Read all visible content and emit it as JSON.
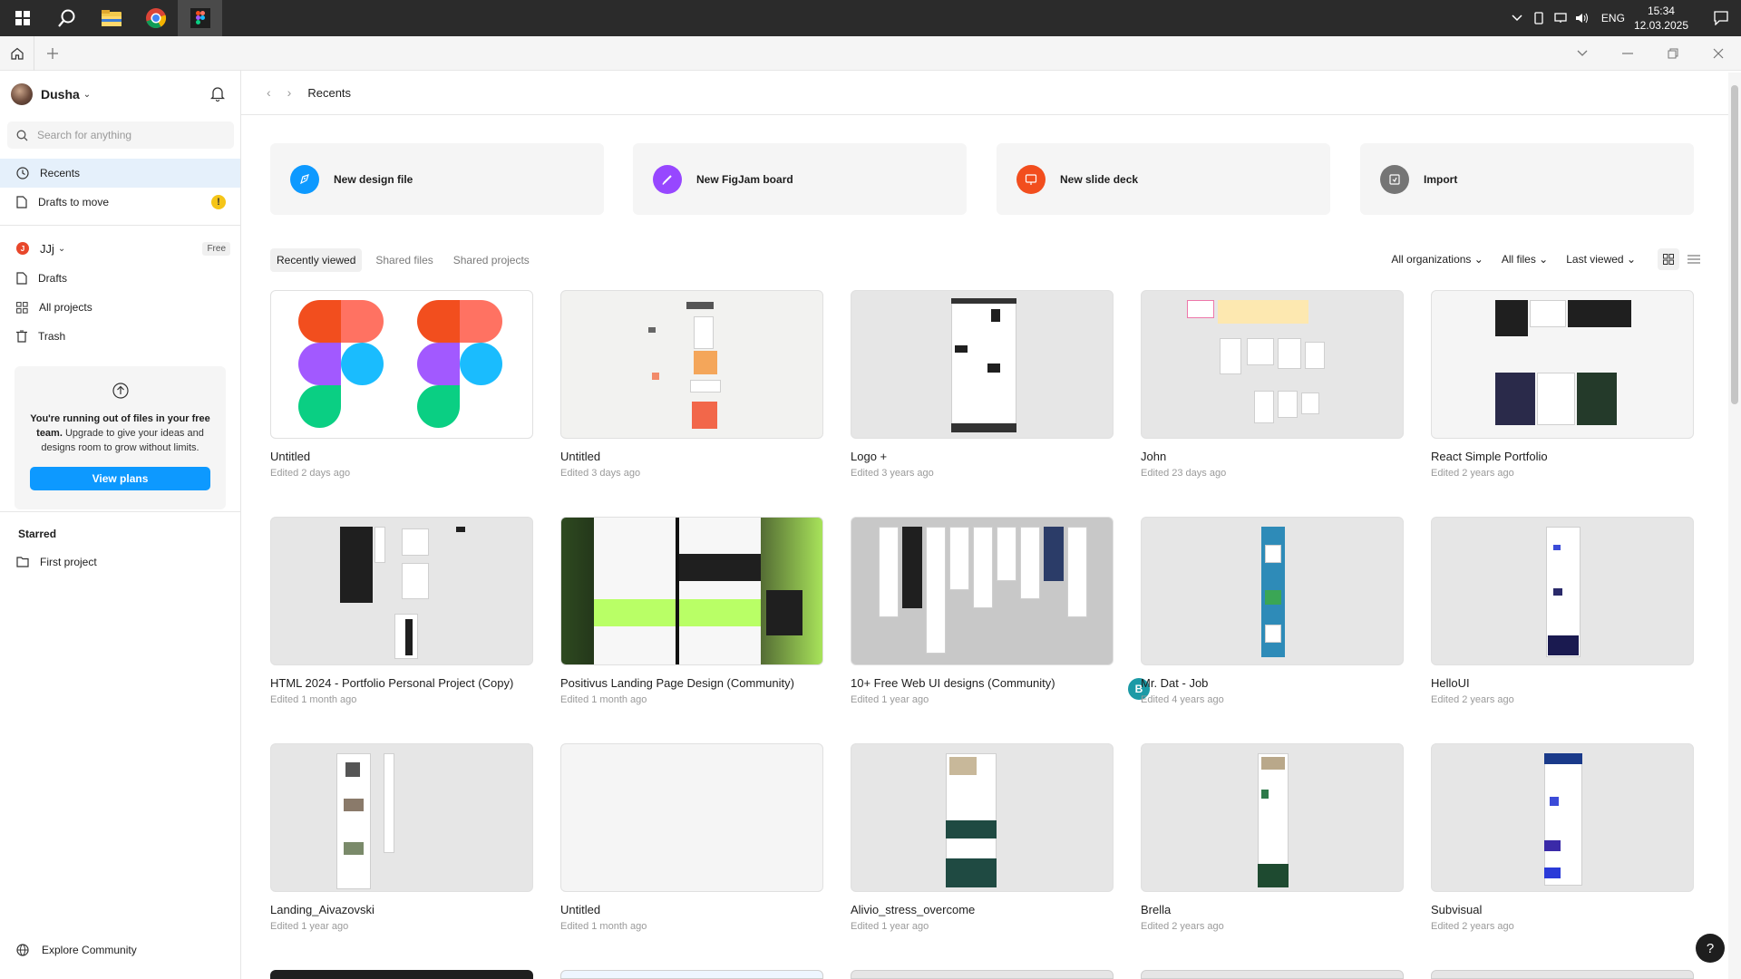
{
  "taskbar": {
    "lang": "ENG",
    "time": "15:34",
    "date": "12.03.2025"
  },
  "sidebar": {
    "user_name": "Dusha",
    "search_placeholder": "Search for anything",
    "nav": [
      {
        "label": "Recents"
      },
      {
        "label": "Drafts to move",
        "badge": "!"
      }
    ],
    "team": {
      "initial": "J",
      "name": "JJj",
      "plan": "Free"
    },
    "team_nav": [
      {
        "label": "Drafts"
      },
      {
        "label": "All projects"
      },
      {
        "label": "Trash"
      }
    ],
    "upgrade": {
      "bold": "You're running out of files in your free team.",
      "text": " Upgrade to give your ideas and designs room to grow without limits.",
      "button": "View plans"
    },
    "starred_title": "Starred",
    "starred": [
      {
        "label": "First project"
      }
    ],
    "explore": "Explore Community"
  },
  "main": {
    "breadcrumb": "Recents",
    "actions": [
      {
        "label": "New design file",
        "color": "#0d99ff"
      },
      {
        "label": "New FigJam board",
        "color": "#9747ff"
      },
      {
        "label": "New slide deck",
        "color": "#f24e1e"
      },
      {
        "label": "Import",
        "color": "#757575"
      }
    ],
    "filters": [
      "Recently viewed",
      "Shared files",
      "Shared projects"
    ],
    "sorts": [
      "All organizations",
      "All files",
      "Last viewed"
    ],
    "files": [
      {
        "name": "Untitled",
        "edited": "Edited 2 days ago"
      },
      {
        "name": "Untitled",
        "edited": "Edited 3 days ago"
      },
      {
        "name": "Logo +",
        "edited": "Edited 3 years ago"
      },
      {
        "name": "John",
        "edited": "Edited 23 days ago"
      },
      {
        "name": "React Simple Portfolio",
        "edited": "Edited 2 years ago"
      },
      {
        "name": "HTML 2024 - Portfolio Personal Project (Copy)",
        "edited": "Edited 1 month ago"
      },
      {
        "name": "Positivus Landing Page Design (Community)",
        "edited": "Edited 1 month ago"
      },
      {
        "name": "10+ Free Web UI designs (Community)",
        "edited": "Edited 1 year ago",
        "badge": "B"
      },
      {
        "name": "Mr. Dat - Job",
        "edited": "Edited 4 years ago"
      },
      {
        "name": "HelloUI",
        "edited": "Edited 2 years ago"
      },
      {
        "name": "Landing_Aivazovski",
        "edited": "Edited 1 year ago"
      },
      {
        "name": "Untitled",
        "edited": "Edited 1 month ago"
      },
      {
        "name": "Alivio_stress_overcome",
        "edited": "Edited 1 year ago"
      },
      {
        "name": "Brella",
        "edited": "Edited 2 years ago"
      },
      {
        "name": "Subvisual",
        "edited": "Edited 2 years ago"
      }
    ],
    "help": "?"
  }
}
